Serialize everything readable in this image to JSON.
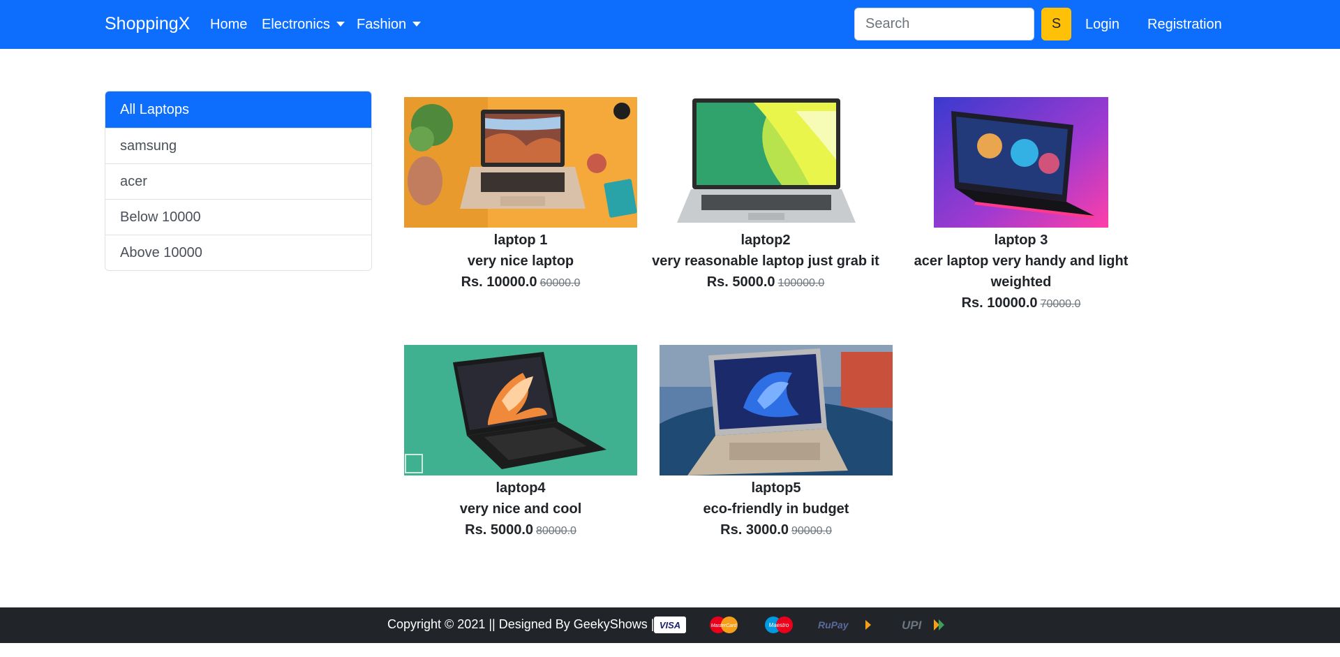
{
  "navbar": {
    "brand": "ShoppingX",
    "links": {
      "home": "Home",
      "electronics": "Electronics",
      "fashion": "Fashion",
      "login": "Login",
      "registration": "Registration"
    },
    "search": {
      "placeholder": "Search",
      "button_label": "S"
    },
    "colors": {
      "background": "#0d6efd",
      "search_button": "#ffc107"
    }
  },
  "sidebar": {
    "items": [
      {
        "label": "All Laptops",
        "active": true
      },
      {
        "label": "samsung",
        "active": false
      },
      {
        "label": "acer",
        "active": false
      },
      {
        "label": "Below 10000",
        "active": false
      },
      {
        "label": "Above 10000",
        "active": false
      }
    ]
  },
  "products": [
    {
      "title": "laptop 1",
      "description": "very nice laptop",
      "price": "Rs. 10000.0",
      "mrp": "60000.0"
    },
    {
      "title": "laptop2",
      "description": "very reasonable laptop just grab it",
      "price": "Rs. 5000.0",
      "mrp": "100000.0"
    },
    {
      "title": "laptop 3",
      "description": "acer laptop very handy and light weighted",
      "price": "Rs. 10000.0",
      "mrp": "70000.0"
    },
    {
      "title": "laptop4",
      "description": "very nice and cool",
      "price": "Rs. 5000.0",
      "mrp": "80000.0"
    },
    {
      "title": "laptop5",
      "description": "eco-friendly in budget",
      "price": "Rs. 3000.0",
      "mrp": "90000.0"
    }
  ],
  "footer": {
    "text": "Copyright © 2021 || Designed By GeekyShows ||",
    "payment_icons": [
      "visa-icon",
      "mastercard-icon",
      "maestro-icon",
      "rupay-icon",
      "upi-icon"
    ],
    "payment_labels": {
      "visa": "VISA",
      "mastercard": "MasterCard",
      "maestro": "Maestro",
      "rupay": "RuPay",
      "upi": "UPI"
    }
  }
}
